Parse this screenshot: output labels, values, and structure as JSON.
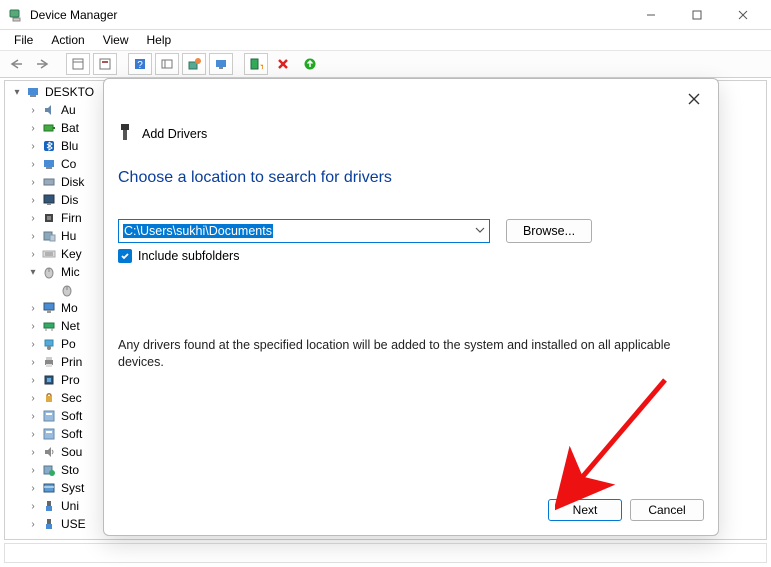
{
  "window": {
    "title": "Device Manager",
    "menu": [
      "File",
      "Action",
      "View",
      "Help"
    ]
  },
  "tree": {
    "root": {
      "label": "DESKTO",
      "expanded": true
    },
    "items": [
      {
        "label": "Au",
        "icon": "audio"
      },
      {
        "label": "Bat",
        "icon": "battery"
      },
      {
        "label": "Blu",
        "icon": "bluetooth"
      },
      {
        "label": "Co",
        "icon": "computer"
      },
      {
        "label": "Disk",
        "icon": "disk"
      },
      {
        "label": "Dis",
        "icon": "display"
      },
      {
        "label": "Firn",
        "icon": "firmware"
      },
      {
        "label": "Hu",
        "icon": "hid"
      },
      {
        "label": "Key",
        "icon": "keyboard"
      },
      {
        "label": "Mic",
        "icon": "mouse",
        "expanded": true,
        "child": ""
      },
      {
        "label": "Mo",
        "icon": "monitor"
      },
      {
        "label": "Net",
        "icon": "network"
      },
      {
        "label": "Po",
        "icon": "port"
      },
      {
        "label": "Prin",
        "icon": "printer"
      },
      {
        "label": "Pro",
        "icon": "processor"
      },
      {
        "label": "Sec",
        "icon": "security"
      },
      {
        "label": "Soft",
        "icon": "software"
      },
      {
        "label": "Soft",
        "icon": "software"
      },
      {
        "label": "Sou",
        "icon": "sound"
      },
      {
        "label": "Sto",
        "icon": "storage"
      },
      {
        "label": "Syst",
        "icon": "system"
      },
      {
        "label": "Uni",
        "icon": "usb"
      },
      {
        "label": "USE",
        "icon": "usb"
      }
    ]
  },
  "dialog": {
    "wizard_title": "Add Drivers",
    "heading": "Choose a location to search for drivers",
    "path_value": "C:\\Users\\sukhi\\Documents",
    "browse_label": "Browse...",
    "include_subfolders_label": "Include subfolders",
    "include_subfolders_checked": true,
    "description": "Any drivers found at the specified location will be added to the system and installed on all applicable devices.",
    "next_label": "Next",
    "cancel_label": "Cancel"
  }
}
